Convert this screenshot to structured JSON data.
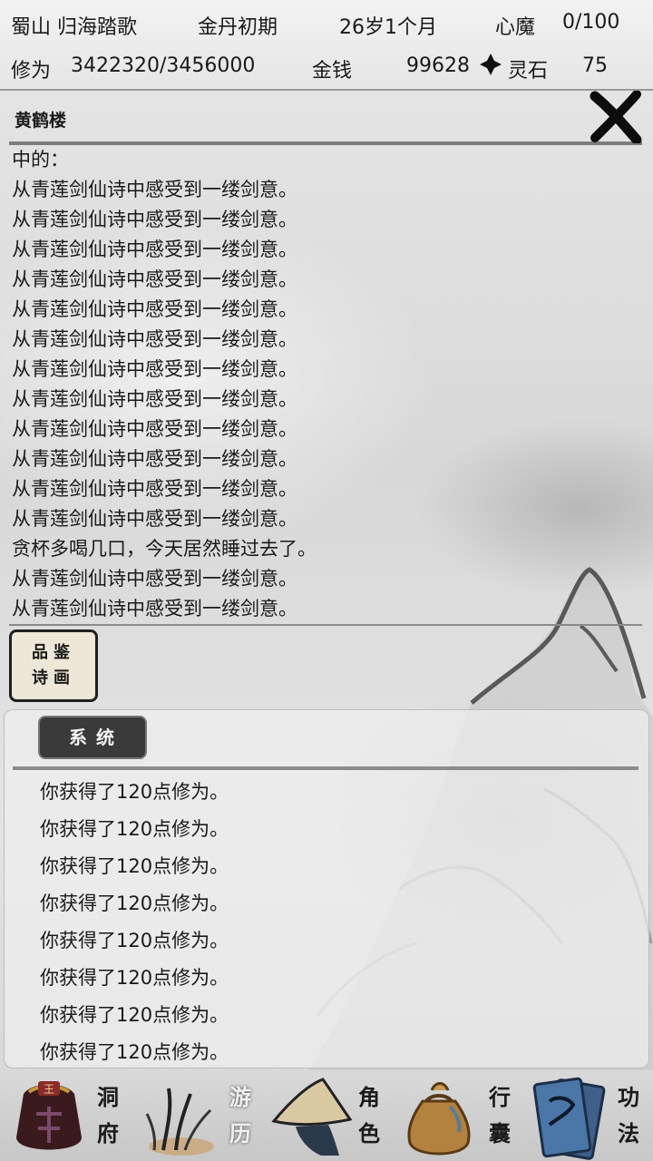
{
  "status": {
    "location": "蜀山 归海踏歌",
    "realm": "金丹初期",
    "age": "26岁1个月",
    "demon_label": "心魔",
    "demon_value": "0/100",
    "cultivation_label": "修为",
    "cultivation_value": "3422320/3456000",
    "money_label": "金钱",
    "money_value": "99628",
    "spirit_label": "灵石",
    "spirit_value": "75"
  },
  "panel": {
    "title": "黄鹤楼",
    "close_icon": "close-x-icon"
  },
  "log": [
    "中的：",
    "从青莲剑仙诗中感受到一缕剑意。",
    "从青莲剑仙诗中感受到一缕剑意。",
    "从青莲剑仙诗中感受到一缕剑意。",
    "从青莲剑仙诗中感受到一缕剑意。",
    "从青莲剑仙诗中感受到一缕剑意。",
    "从青莲剑仙诗中感受到一缕剑意。",
    "从青莲剑仙诗中感受到一缕剑意。",
    "从青莲剑仙诗中感受到一缕剑意。",
    "从青莲剑仙诗中感受到一缕剑意。",
    "从青莲剑仙诗中感受到一缕剑意。",
    "从青莲剑仙诗中感受到一缕剑意。",
    "从青莲剑仙诗中感受到一缕剑意。",
    "贪杯多喝几口，今天居然睡过去了。",
    "从青莲剑仙诗中感受到一缕剑意。",
    "从青莲剑仙诗中感受到一缕剑意。"
  ],
  "appraise_button": {
    "line1": "品鉴",
    "line2": "诗画"
  },
  "system": {
    "tab_label": "系统",
    "messages": [
      "你获得了120点修为。",
      "你获得了120点修为。",
      "你获得了120点修为。",
      "你获得了120点修为。",
      "你获得了120点修为。",
      "你获得了120点修为。",
      "你获得了120点修为。",
      "你获得了120点修为。"
    ]
  },
  "nav": [
    {
      "icon": "cave-bag-icon",
      "top": "洞",
      "bottom": "府"
    },
    {
      "icon": "reeds-icon",
      "top": "游",
      "bottom": "历"
    },
    {
      "icon": "straw-hat-icon",
      "top": "角",
      "bottom": "色"
    },
    {
      "icon": "pouch-icon",
      "top": "行",
      "bottom": "囊"
    },
    {
      "icon": "scroll-book-icon",
      "top": "功",
      "bottom": "法"
    }
  ],
  "colors": {
    "panel_bg": "#eeeeee",
    "tab_bg": "#3a3a3a",
    "button_bg": "#ece7d6",
    "ink": "#1a1a1a"
  }
}
